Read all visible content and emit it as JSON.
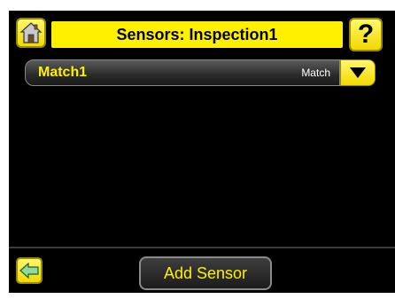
{
  "header": {
    "title": "Sensors: Inspection1",
    "home_icon": "home-icon",
    "help_label": "?"
  },
  "sensors": [
    {
      "name": "Match1",
      "type": "Match"
    }
  ],
  "footer": {
    "back_icon": "back-arrow-icon",
    "add_sensor_label": "Add Sensor"
  },
  "colors": {
    "accent": "#fff000",
    "background": "#000000"
  }
}
